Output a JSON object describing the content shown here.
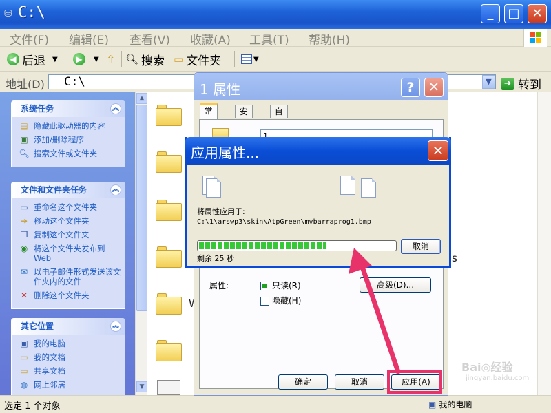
{
  "window": {
    "title": "C:\\",
    "minimize": "_",
    "maximize": "□",
    "close": "✕"
  },
  "menu": [
    "文件(F)",
    "编辑(E)",
    "查看(V)",
    "收藏(A)",
    "工具(T)",
    "帮助(H)"
  ],
  "toolbar": {
    "back": "后退",
    "search": "搜索",
    "folders": "文件夹"
  },
  "address": {
    "label": "地址(D)",
    "value": "C:\\",
    "goto": "转到"
  },
  "taskpane": {
    "system": {
      "title": "系统任务",
      "items": [
        "隐藏此驱动器的内容",
        "添加/删除程序",
        "搜索文件或文件夹"
      ]
    },
    "fileTasks": {
      "title": "文件和文件夹任务",
      "items": [
        "重命名这个文件夹",
        "移动这个文件夹",
        "复制这个文件夹",
        "将这个文件夹发布到Web",
        "以电子邮件形式发送该文件夹内的文件",
        "删除这个文件夹"
      ]
    },
    "otherPlaces": {
      "title": "其它位置",
      "items": [
        "我的电脑",
        "我的文档",
        "共享文档",
        "网上邻居"
      ]
    }
  },
  "content": {
    "partial_labels": [
      "W",
      "s"
    ]
  },
  "status": {
    "left": "选定 1 个对象",
    "right": "我的电脑"
  },
  "properties": {
    "title": "1 属性",
    "help": "?",
    "close": "✕",
    "tabs": [
      "常规",
      "安全",
      "自定义"
    ],
    "name_value": "1",
    "attributes_label": "属性:",
    "readonly": "只读(R)",
    "hidden": "隐藏(H)",
    "advanced": "高级(D)...",
    "ok": "确定",
    "cancel": "取消",
    "apply": "应用(A)"
  },
  "applyDialog": {
    "title": "应用属性...",
    "close": "✕",
    "applying_to_label": "将属性应用于:",
    "path": "C:\\1\\arswp3\\skin\\AtpGreen\\mvbarraprog1.bmp",
    "progress": 0.65,
    "remaining": "剩余 25 秒",
    "cancel": "取消"
  },
  "watermark": {
    "site": "jingyan.baidu.com"
  },
  "colors": {
    "title_blue": "#0a4ed6",
    "progress_green": "#37c837",
    "annotation_red": "#e8336a"
  }
}
